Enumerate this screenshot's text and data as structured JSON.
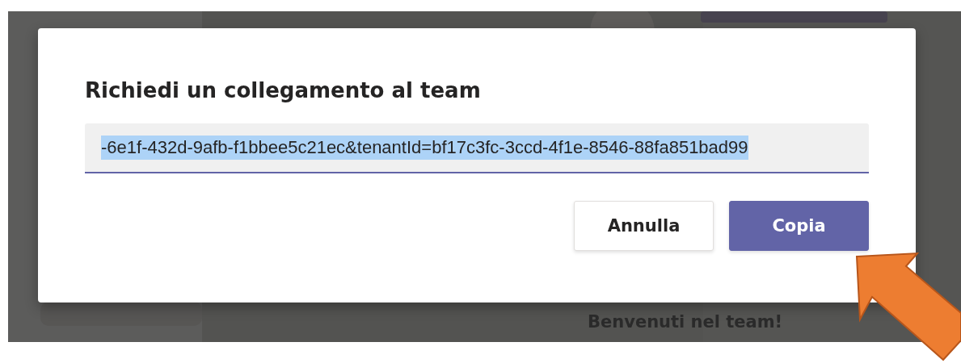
{
  "dialog": {
    "title": "Richiedi un collegamento al team",
    "link_field": {
      "value": "-6e1f-432d-9afb-f1bbee5c21ec&tenantId=bf17c3fc-3ccd-4f1e-8546-88fa851bad99",
      "text_selected": true
    },
    "buttons": [
      {
        "label": "Annulla",
        "kind": "secondary"
      },
      {
        "label": "Copia",
        "kind": "primary"
      }
    ]
  },
  "background_page": {
    "heading": "Benvenuti nel team!"
  }
}
